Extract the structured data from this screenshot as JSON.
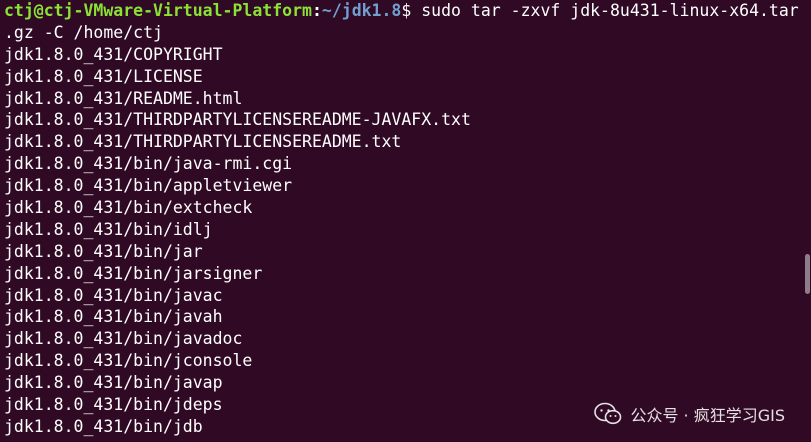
{
  "prompt": {
    "user_host": "ctj@ctj-VMware-Virtual-Platform",
    "separator": ":",
    "path": "~/jdk1.8",
    "symbol": "$",
    "command": " sudo tar -zxvf jdk-8u431-linux-x64.tar"
  },
  "output_lines": [
    ".gz -C /home/ctj",
    "jdk1.8.0_431/COPYRIGHT",
    "jdk1.8.0_431/LICENSE",
    "jdk1.8.0_431/README.html",
    "jdk1.8.0_431/THIRDPARTYLICENSEREADME-JAVAFX.txt",
    "jdk1.8.0_431/THIRDPARTYLICENSEREADME.txt",
    "jdk1.8.0_431/bin/java-rmi.cgi",
    "jdk1.8.0_431/bin/appletviewer",
    "jdk1.8.0_431/bin/extcheck",
    "jdk1.8.0_431/bin/idlj",
    "jdk1.8.0_431/bin/jar",
    "jdk1.8.0_431/bin/jarsigner",
    "jdk1.8.0_431/bin/javac",
    "jdk1.8.0_431/bin/javah",
    "jdk1.8.0_431/bin/javadoc",
    "jdk1.8.0_431/bin/jconsole",
    "jdk1.8.0_431/bin/javap",
    "jdk1.8.0_431/bin/jdeps",
    "jdk1.8.0_431/bin/jdb"
  ],
  "watermark": {
    "icon": "wechat-icon",
    "text": "公众号 · 疯狂学习GIS"
  },
  "colors": {
    "background": "#300a24",
    "prompt_user": "#8ae234",
    "prompt_path": "#729fcf",
    "text": "#ffffff"
  }
}
